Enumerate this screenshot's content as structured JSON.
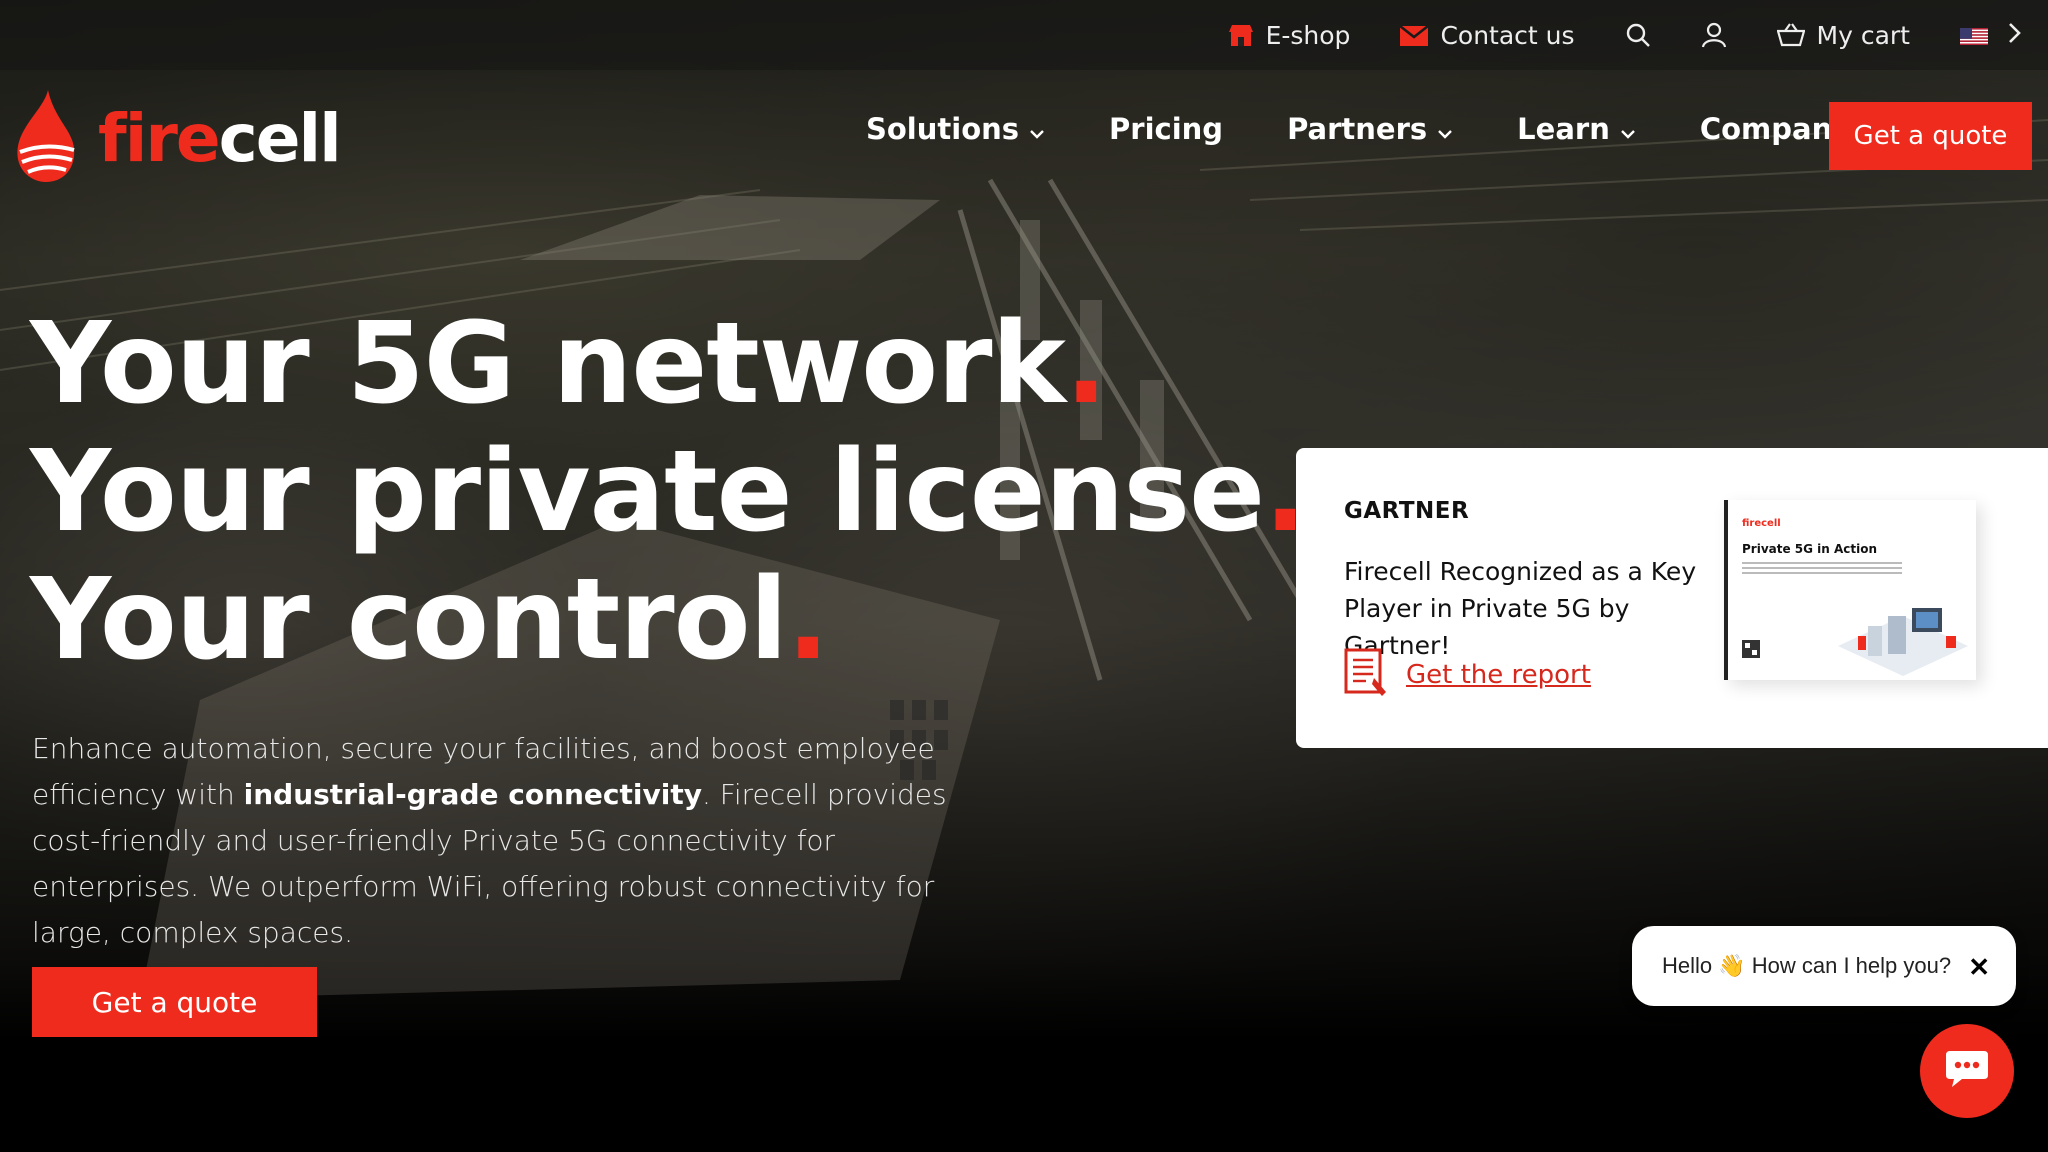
{
  "topbar": {
    "eshop_label": "E-shop",
    "contact_label": "Contact us",
    "cart_label": "My cart"
  },
  "logo": {
    "part1": "fire",
    "part2": "cell"
  },
  "nav": {
    "items": [
      {
        "label": "Solutions",
        "dropdown": true
      },
      {
        "label": "Pricing",
        "dropdown": false
      },
      {
        "label": "Partners",
        "dropdown": true
      },
      {
        "label": "Learn",
        "dropdown": true
      },
      {
        "label": "Company",
        "dropdown": true
      }
    ],
    "cta_label": "Get a quote"
  },
  "hero": {
    "line1": "Your 5G network",
    "line2": "Your private license",
    "line3": "Your control",
    "punct": ".",
    "desc_part1": "Enhance automation, secure your facilities, and boost employee efficiency with ",
    "desc_bold": "industrial-grade connectivity",
    "desc_part2": ". Firecell provides cost-friendly and user-friendly Private 5G connectivity for enterprises. We outperform WiFi, offering robust connectivity for large, complex spaces.",
    "cta_label": "Get a quote"
  },
  "card": {
    "tag": "GARTNER",
    "title": "Firecell Recognized as a Key Player in Private 5G by Gartner!",
    "link_label": "Get the report",
    "report_logo": "firecell",
    "report_title": "Private 5G in Action"
  },
  "chat": {
    "message": "Hello 👋 How can I help you?",
    "close": "✕"
  },
  "colors": {
    "brand_red": "#ef2b1d",
    "card_bg": "#ffffff"
  }
}
